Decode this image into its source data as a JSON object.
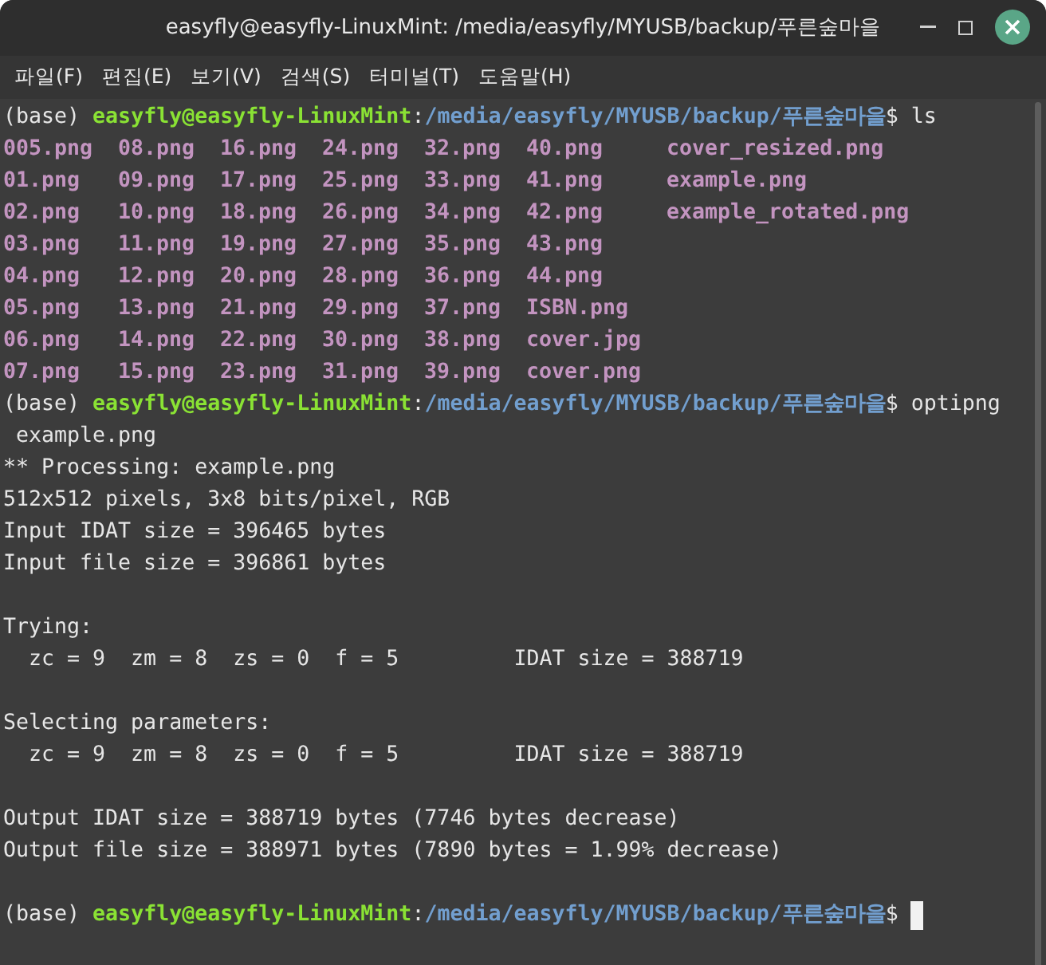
{
  "window": {
    "title": "easyfly@easyfly-LinuxMint: /media/easyfly/MYUSB/backup/푸른숲마을"
  },
  "menu": [
    "파일(F)",
    "편집(E)",
    "보기(V)",
    "검색(S)",
    "터미널(T)",
    "도움말(H)"
  ],
  "lines": [
    {
      "kind": "prompt",
      "segments": [
        {
          "kind": "plain",
          "text": "(base) "
        },
        {
          "kind": "user",
          "text": "easyfly@easyfly-LinuxMint"
        },
        {
          "kind": "plain",
          "text": ":"
        },
        {
          "kind": "path",
          "text": "/media/easyfly/MYUSB/backup/푸른숲마을"
        },
        {
          "kind": "plain",
          "text": "$ ls"
        }
      ]
    },
    {
      "kind": "listing",
      "cells": [
        "005.png",
        "08.png",
        "16.png",
        "24.png",
        "32.png",
        "40.png",
        "cover_resized.png"
      ]
    },
    {
      "kind": "listing",
      "cells": [
        "01.png",
        "09.png",
        "17.png",
        "25.png",
        "33.png",
        "41.png",
        "example.png"
      ]
    },
    {
      "kind": "listing",
      "cells": [
        "02.png",
        "10.png",
        "18.png",
        "26.png",
        "34.png",
        "42.png",
        "example_rotated.png"
      ]
    },
    {
      "kind": "listing",
      "cells": [
        "03.png",
        "11.png",
        "19.png",
        "27.png",
        "35.png",
        "43.png"
      ]
    },
    {
      "kind": "listing",
      "cells": [
        "04.png",
        "12.png",
        "20.png",
        "28.png",
        "36.png",
        "44.png"
      ]
    },
    {
      "kind": "listing",
      "cells": [
        "05.png",
        "13.png",
        "21.png",
        "29.png",
        "37.png",
        "ISBN.png"
      ]
    },
    {
      "kind": "listing",
      "cells": [
        "06.png",
        "14.png",
        "22.png",
        "30.png",
        "38.png",
        "cover.jpg"
      ]
    },
    {
      "kind": "listing",
      "cells": [
        "07.png",
        "15.png",
        "23.png",
        "31.png",
        "39.png",
        "cover.png"
      ]
    },
    {
      "kind": "prompt",
      "segments": [
        {
          "kind": "plain",
          "text": "(base) "
        },
        {
          "kind": "user",
          "text": "easyfly@easyfly-LinuxMint"
        },
        {
          "kind": "plain",
          "text": ":"
        },
        {
          "kind": "path",
          "text": "/media/easyfly/MYUSB/backup/푸른숲마을"
        },
        {
          "kind": "plain",
          "text": "$ optipng"
        }
      ]
    },
    {
      "kind": "output",
      "text": " example.png"
    },
    {
      "kind": "output",
      "text": "** Processing: example.png"
    },
    {
      "kind": "output",
      "text": "512x512 pixels, 3x8 bits/pixel, RGB"
    },
    {
      "kind": "output",
      "text": "Input IDAT size = 396465 bytes"
    },
    {
      "kind": "output",
      "text": "Input file size = 396861 bytes"
    },
    {
      "kind": "blank"
    },
    {
      "kind": "output",
      "text": "Trying:"
    },
    {
      "kind": "output",
      "text": "  zc = 9  zm = 8  zs = 0  f = 5         IDAT size = 388719"
    },
    {
      "kind": "blank"
    },
    {
      "kind": "output",
      "text": "Selecting parameters:"
    },
    {
      "kind": "output",
      "text": "  zc = 9  zm = 8  zs = 0  f = 5         IDAT size = 388719"
    },
    {
      "kind": "blank"
    },
    {
      "kind": "output",
      "text": "Output IDAT size = 388719 bytes (7746 bytes decrease)"
    },
    {
      "kind": "output",
      "text": "Output file size = 388971 bytes (7890 bytes = 1.99% decrease)"
    },
    {
      "kind": "blank"
    },
    {
      "kind": "prompt",
      "cursor": true,
      "segments": [
        {
          "kind": "plain",
          "text": "(base) "
        },
        {
          "kind": "user",
          "text": "easyfly@easyfly-LinuxMint"
        },
        {
          "kind": "plain",
          "text": ":"
        },
        {
          "kind": "path",
          "text": "/media/easyfly/MYUSB/backup/푸른숲마을"
        },
        {
          "kind": "plain",
          "text": "$ "
        }
      ]
    }
  ]
}
